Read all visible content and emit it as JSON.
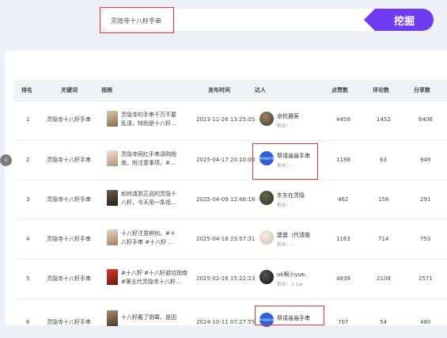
{
  "search": {
    "query": "灵隐寺十八籽手串",
    "button_label": "挖掘"
  },
  "table": {
    "headers": [
      "排名",
      "关键词",
      "视频",
      "发布时间",
      "达人",
      "点赞数",
      "评论数",
      "分享数"
    ],
    "rows": [
      {
        "rank": "1",
        "keyword": "灵隐寺十八籽手串",
        "video_line1": "灵隐寺的手串千万不要",
        "video_line2": "乱请，特别是十八籽…",
        "time": "2023-11-26 13:25:05",
        "talent": "余杭雅客",
        "fans": "粉丝：-",
        "likes": "4459",
        "comments": "1452",
        "shares": "6406"
      },
      {
        "rank": "2",
        "keyword": "灵隐寺十八籽手串",
        "video_line1": "灵隐寺网红手串请购指",
        "video_line2": "南，附注意事项。#…",
        "time": "2025-04-17 20:10:00",
        "talent": "帮请庙庙手串",
        "fans": "粉丝：-",
        "likes": "1188",
        "comments": "63",
        "shares": "949"
      },
      {
        "rank": "3",
        "keyword": "灵隐寺十八籽手串",
        "video_line1": "如何请到正品的灵隐十",
        "video_line2": "八籽，今天用一条视…",
        "time": "2025-04-09 12:46:18",
        "talent": "东东在灵隐",
        "fans": "粉丝：-",
        "likes": "462",
        "comments": "158",
        "shares": "291"
      },
      {
        "rank": "4",
        "keyword": "灵隐寺十八籽手串",
        "video_line1": "十八籽注意辨别。#十",
        "video_line2": "八籽手串 #十八籽 …",
        "time": "2025-04-18 23:57:31",
        "talent": "堡堡（代请版",
        "fans": "粉丝：-",
        "likes": "1163",
        "comments": "714",
        "shares": "753"
      },
      {
        "rank": "5",
        "keyword": "灵隐寺十八籽手串",
        "video_line1": "#十八籽 #十八籽避坑指南",
        "video_line2": "#第五代灵隐寺十八籽…",
        "time": "2025-02-16 15:22:23",
        "talent": "ok啊小yue.",
        "fans": "粉丝：1.1w",
        "likes": "4839",
        "comments": "2108",
        "shares": "2571"
      },
      {
        "rank": "6",
        "keyword": "灵隐寺十八籽手串",
        "video_line1": "十八籽戴了倒霉，是因",
        "video_line2": "",
        "time": "2024-10-11 07:27:55",
        "talent": "帮请庙庙手串",
        "fans": "",
        "likes": "707",
        "comments": "54",
        "shares": "480"
      }
    ]
  },
  "avatar_badge_text": "帮请庙庙手串",
  "colors": {
    "accent": "#6f3bf0",
    "highlight": "#e03b3b",
    "avatar_blue": "#2d5fd6"
  }
}
